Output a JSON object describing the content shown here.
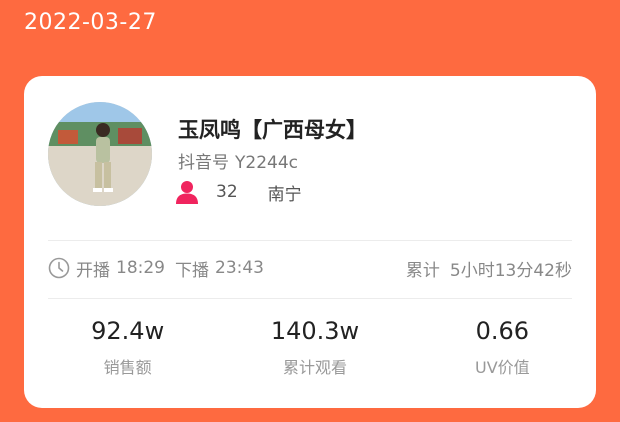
{
  "date": "2022-03-27",
  "profile": {
    "name": "玉凤鸣【广西母女】",
    "douyin_label": "抖音号",
    "douyin_id": "Y2244c",
    "followers": "32",
    "city": "南宁",
    "person_icon": "person-icon",
    "person_icon_color": "#F0245E"
  },
  "live": {
    "clock_icon": "clock-icon",
    "start_label": "开播",
    "start_time": "18:29",
    "end_label": "下播",
    "end_time": "23:43",
    "total_label": "累计",
    "total_duration": "5小时13分42秒"
  },
  "stats": [
    {
      "value": "92.4w",
      "label": "销售额"
    },
    {
      "value": "140.3w",
      "label": "累计观看"
    },
    {
      "value": "0.66",
      "label": "UV价值"
    }
  ],
  "colors": {
    "background": "#FE6A40",
    "card": "#FFFFFF"
  }
}
